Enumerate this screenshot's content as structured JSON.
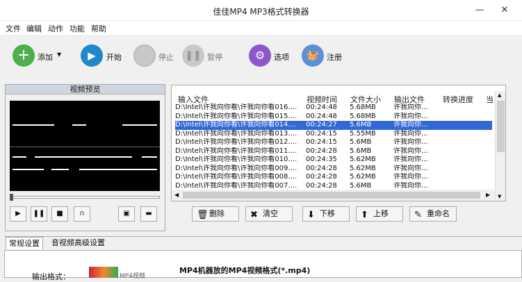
{
  "app": {
    "title": "佳佳MP4 MP3格式转换器"
  },
  "menu": [
    "文件",
    "编辑",
    "动作",
    "功能",
    "帮助"
  ],
  "toolbar": {
    "add": "添加",
    "start": "开始",
    "stop": "停止",
    "pause": "暂停",
    "options": "选项",
    "register": "注册"
  },
  "preview": {
    "title": "视频预览"
  },
  "table": {
    "headers": [
      "输入文件",
      "视频时间",
      "文件大小",
      "输出文件",
      "转换进度",
      "当"
    ],
    "rows": [
      [
        "D:\\Intel\\许我向你看\\许我向你看016....",
        "00:24:48",
        "5.68MB",
        "许我向你..."
      ],
      [
        "D:\\Intel\\许我向你看\\许我向你看015....",
        "00:24:48",
        "5.68MB",
        "许我向你..."
      ],
      [
        "D:\\Intel\\许我向你看\\许我向你看014....",
        "00:24:27",
        "5.6MB",
        "许我向你..."
      ],
      [
        "D:\\Intel\\许我向你看\\许我向你看013....",
        "00:24:15",
        "5.55MB",
        "许我向你..."
      ],
      [
        "D:\\Intel\\许我向你看\\许我向你看012....",
        "00:24:15",
        "5.6MB",
        "许我向你..."
      ],
      [
        "D:\\Intel\\许我向你看\\许我向你看011....",
        "00:24:28",
        "5.6MB",
        "许我向你..."
      ],
      [
        "D:\\Intel\\许我向你看\\许我向你看010....",
        "00:24:35",
        "5.62MB",
        "许我向你..."
      ],
      [
        "D:\\Intel\\许我向你看\\许我向你看009....",
        "00:24:28",
        "5.62MB",
        "许我向你..."
      ],
      [
        "D:\\Intel\\许我向你看\\许我向你看008....",
        "00:24:28",
        "5.62MB",
        "许我向你..."
      ],
      [
        "D:\\Intel\\许我向你看\\许我向你看007....",
        "00:24:28",
        "5.6MB",
        "许我向你..."
      ]
    ],
    "selected_row": 2
  },
  "actions": {
    "delete": "删除",
    "clear": "清空",
    "down": "下移",
    "up": "上移",
    "rename": "重命名"
  },
  "tabs": [
    "常规设置",
    "音视频高级设置"
  ],
  "settings": {
    "output_format_label": "输出格式：",
    "format_name": "MP4机器放的MP4视频格式(*.mp4)",
    "thumb_text": "MP4视频"
  },
  "colors": {
    "accent": "#3367d6",
    "add_icon": "#4cae4c",
    "start_icon": "#1e88c8",
    "options_icon": "#8b57c9",
    "register_icon": "#5b8fd6"
  }
}
